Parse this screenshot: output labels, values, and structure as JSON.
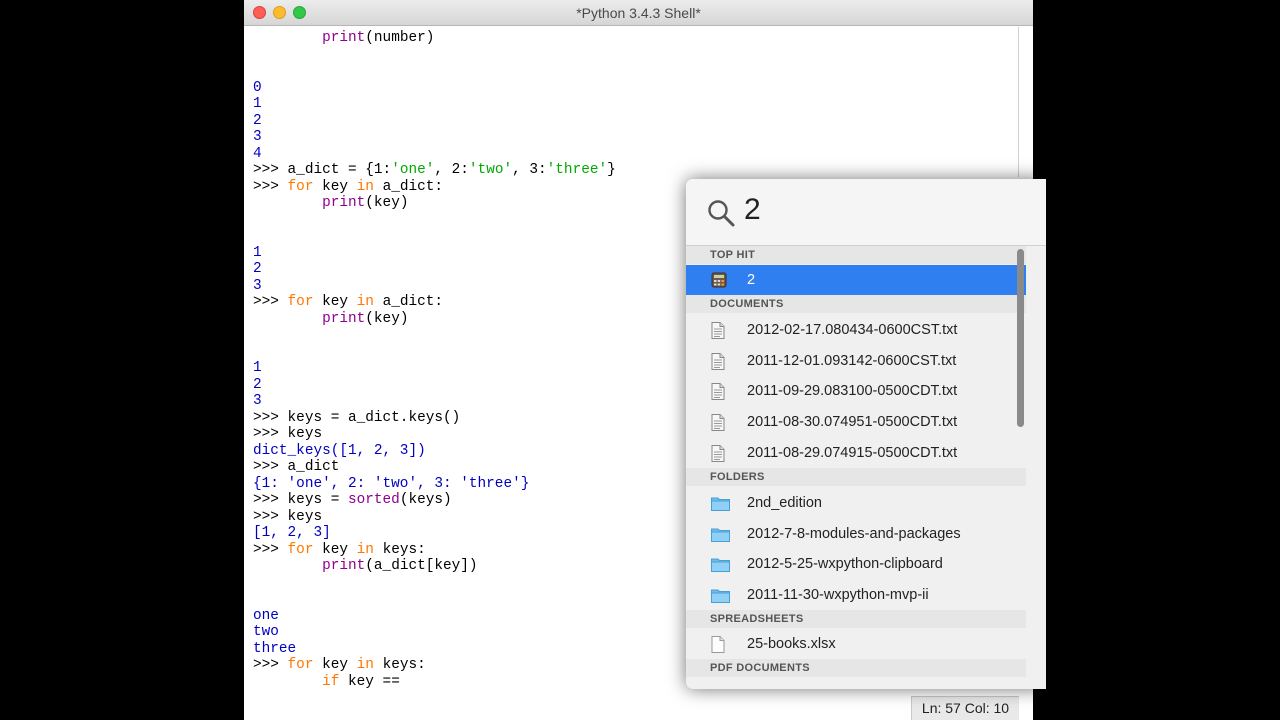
{
  "window": {
    "title": "*Python 3.4.3 Shell*"
  },
  "status": {
    "position": "Ln: 57 Col: 10"
  },
  "code_lines": [
    [
      {
        "t": "        ",
        "c": "code"
      },
      {
        "t": "print",
        "c": "bi"
      },
      {
        "t": "(number)",
        "c": "code"
      }
    ],
    [],
    [],
    [
      {
        "t": "0",
        "c": "out"
      }
    ],
    [
      {
        "t": "1",
        "c": "out"
      }
    ],
    [
      {
        "t": "2",
        "c": "out"
      }
    ],
    [
      {
        "t": "3",
        "c": "out"
      }
    ],
    [
      {
        "t": "4",
        "c": "out"
      }
    ],
    [
      {
        "t": ">>> a_dict = {1:",
        "c": "code"
      },
      {
        "t": "'one'",
        "c": "str"
      },
      {
        "t": ", 2:",
        "c": "code"
      },
      {
        "t": "'two'",
        "c": "str"
      },
      {
        "t": ", 3:",
        "c": "code"
      },
      {
        "t": "'three'",
        "c": "str"
      },
      {
        "t": "}",
        "c": "code"
      }
    ],
    [
      {
        "t": ">>> ",
        "c": "code"
      },
      {
        "t": "for",
        "c": "kw"
      },
      {
        "t": " key ",
        "c": "code"
      },
      {
        "t": "in",
        "c": "kw"
      },
      {
        "t": " a_dict:",
        "c": "code"
      }
    ],
    [
      {
        "t": "        ",
        "c": "code"
      },
      {
        "t": "print",
        "c": "bi"
      },
      {
        "t": "(key)",
        "c": "code"
      }
    ],
    [],
    [],
    [
      {
        "t": "1",
        "c": "out"
      }
    ],
    [
      {
        "t": "2",
        "c": "out"
      }
    ],
    [
      {
        "t": "3",
        "c": "out"
      }
    ],
    [
      {
        "t": ">>> ",
        "c": "code"
      },
      {
        "t": "for",
        "c": "kw"
      },
      {
        "t": " key ",
        "c": "code"
      },
      {
        "t": "in",
        "c": "kw"
      },
      {
        "t": " a_dict:",
        "c": "code"
      }
    ],
    [
      {
        "t": "        ",
        "c": "code"
      },
      {
        "t": "print",
        "c": "bi"
      },
      {
        "t": "(key)",
        "c": "code"
      }
    ],
    [],
    [],
    [
      {
        "t": "1",
        "c": "out"
      }
    ],
    [
      {
        "t": "2",
        "c": "out"
      }
    ],
    [
      {
        "t": "3",
        "c": "out"
      }
    ],
    [
      {
        "t": ">>> keys = a_dict.keys()",
        "c": "code"
      }
    ],
    [
      {
        "t": ">>> keys",
        "c": "code"
      }
    ],
    [
      {
        "t": "dict_keys([1, 2, 3])",
        "c": "out"
      }
    ],
    [
      {
        "t": ">>> a_dict",
        "c": "code"
      }
    ],
    [
      {
        "t": "{1: 'one', 2: 'two', 3: 'three'}",
        "c": "out"
      }
    ],
    [
      {
        "t": ">>> keys = ",
        "c": "code"
      },
      {
        "t": "sorted",
        "c": "bi"
      },
      {
        "t": "(keys)",
        "c": "code"
      }
    ],
    [
      {
        "t": ">>> keys",
        "c": "code"
      }
    ],
    [
      {
        "t": "[1, 2, 3]",
        "c": "out"
      }
    ],
    [
      {
        "t": ">>> ",
        "c": "code"
      },
      {
        "t": "for",
        "c": "kw"
      },
      {
        "t": " key ",
        "c": "code"
      },
      {
        "t": "in",
        "c": "kw"
      },
      {
        "t": " keys:",
        "c": "code"
      }
    ],
    [
      {
        "t": "        ",
        "c": "code"
      },
      {
        "t": "print",
        "c": "bi"
      },
      {
        "t": "(a_dict[key])",
        "c": "code"
      }
    ],
    [],
    [],
    [
      {
        "t": "one",
        "c": "out"
      }
    ],
    [
      {
        "t": "two",
        "c": "out"
      }
    ],
    [
      {
        "t": "three",
        "c": "out"
      }
    ],
    [
      {
        "t": ">>> ",
        "c": "code"
      },
      {
        "t": "for",
        "c": "kw"
      },
      {
        "t": " key ",
        "c": "code"
      },
      {
        "t": "in",
        "c": "kw"
      },
      {
        "t": " keys:",
        "c": "code"
      }
    ],
    [
      {
        "t": "        ",
        "c": "code"
      },
      {
        "t": "if",
        "c": "kw"
      },
      {
        "t": " key ==",
        "c": "code"
      }
    ]
  ],
  "spotlight": {
    "query": "2",
    "top_hit_header": "TOP HIT",
    "top_hit": "2",
    "documents_header": "DOCUMENTS",
    "documents": [
      "2012-02-17.080434-0600CST.txt",
      "2011-12-01.093142-0600CST.txt",
      "2011-09-29.083100-0500CDT.txt",
      "2011-08-30.074951-0500CDT.txt",
      "2011-08-29.074915-0500CDT.txt"
    ],
    "folders_header": "FOLDERS",
    "folders": [
      "2nd_edition",
      "2012-7-8-modules-and-packages",
      "2012-5-25-wxpython-clipboard",
      "2011-11-30-wxpython-mvp-ii"
    ],
    "spreadsheets_header": "SPREADSHEETS",
    "spreadsheets": [
      "25-books.xlsx"
    ],
    "pdf_header": "PDF DOCUMENTS"
  }
}
